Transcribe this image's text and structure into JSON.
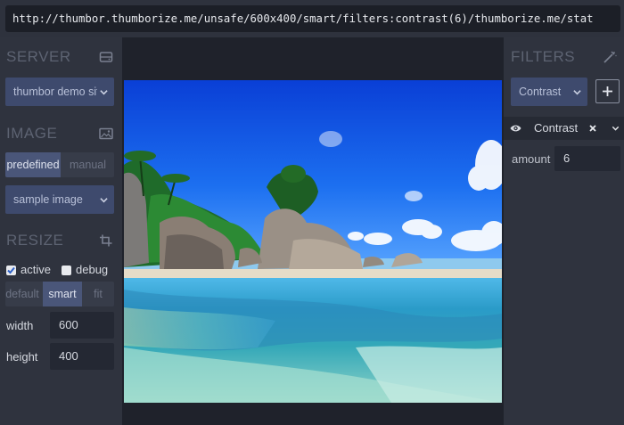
{
  "url": "http://thumbor.thumborize.me/unsafe/600x400/smart/filters:contrast(6)/thumborize.me/stat",
  "left_panel": {
    "server": {
      "title": "SERVER",
      "icon": "server-icon",
      "select_value": "thumbor demo site"
    },
    "image": {
      "title": "IMAGE",
      "icon": "image-icon",
      "mode_options": [
        "predefined",
        "manual"
      ],
      "mode_selected": "predefined",
      "select_value": "sample image"
    },
    "resize": {
      "title": "RESIZE",
      "icon": "crop-icon",
      "active_label": "active",
      "active_checked": true,
      "debug_label": "debug",
      "debug_checked": false,
      "fit_options": [
        "default",
        "smart",
        "fit"
      ],
      "fit_selected": "smart",
      "width_label": "width",
      "width_value": "600",
      "height_label": "height",
      "height_value": "400"
    }
  },
  "right_panel": {
    "title": "FILTERS",
    "icon": "wand-icon",
    "filter_select_value": "Contrast",
    "add_button_icon": "plus-icon",
    "active_filter": {
      "name": "Contrast",
      "icons": [
        "eye-icon",
        "close-icon",
        "chevron-down-icon"
      ],
      "param_label": "amount",
      "param_value": "6"
    }
  },
  "colors": {
    "panel_bg": "#2f333e",
    "select_bg": "#3e4a6d",
    "input_bg": "#242833",
    "heading": "#5d6372"
  }
}
